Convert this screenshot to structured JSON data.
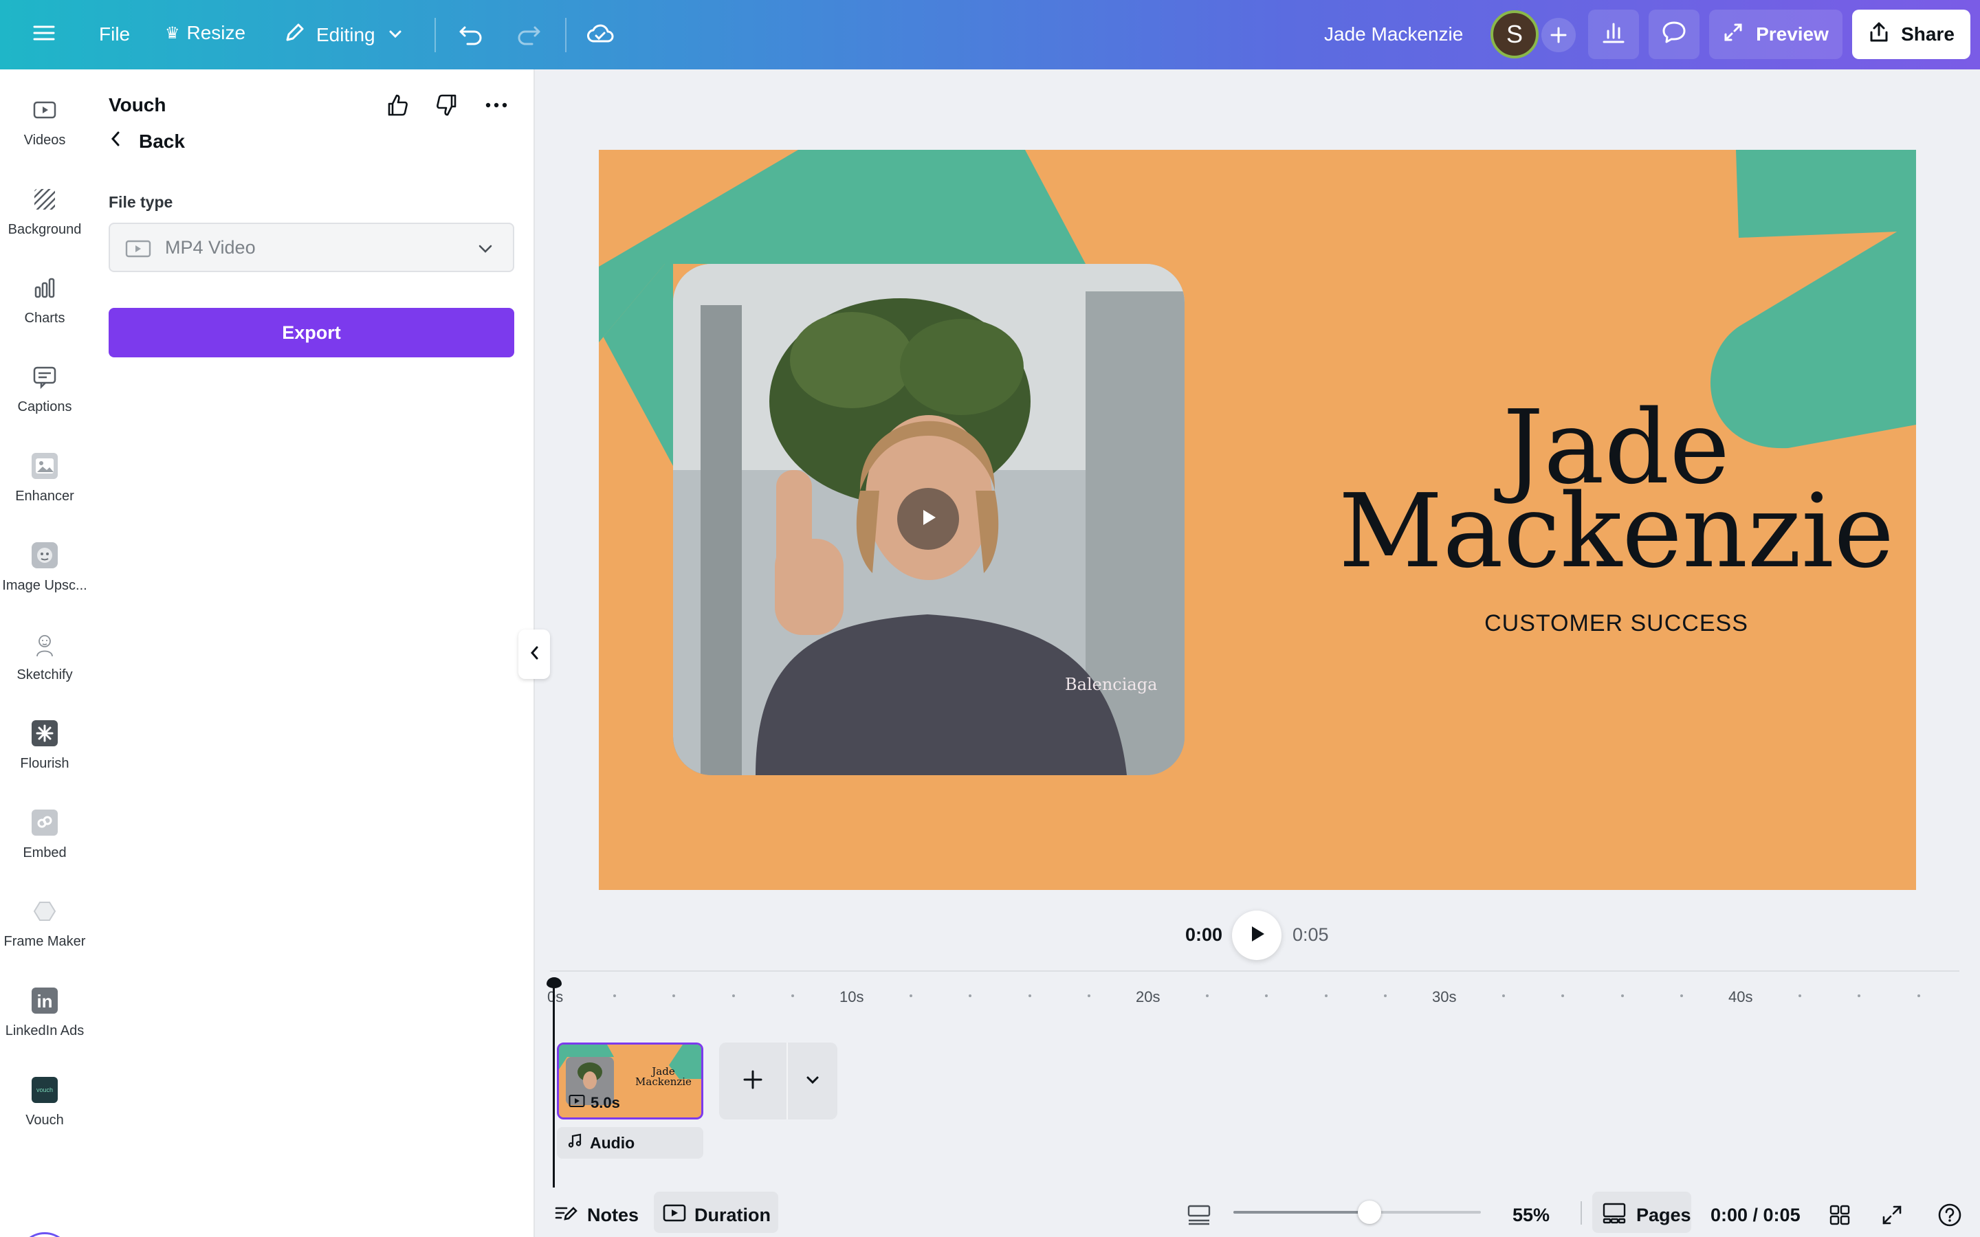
{
  "topbar": {
    "file_label": "File",
    "resize_label": "Resize",
    "editing_label": "Editing",
    "doc_title": "Jade Mackenzie",
    "avatar_initial": "S",
    "preview_label": "Preview",
    "share_label": "Share"
  },
  "rail": {
    "items": [
      {
        "label": "Videos",
        "icon": "video-icon"
      },
      {
        "label": "Background",
        "icon": "background-icon"
      },
      {
        "label": "Charts",
        "icon": "charts-icon"
      },
      {
        "label": "Captions",
        "icon": "captions-icon"
      },
      {
        "label": "Enhancer",
        "icon": "enhancer-icon"
      },
      {
        "label": "Image Upsc...",
        "icon": "image-upscaler-icon"
      },
      {
        "label": "Sketchify",
        "icon": "sketchify-icon"
      },
      {
        "label": "Flourish",
        "icon": "flourish-icon"
      },
      {
        "label": "Embed",
        "icon": "embed-icon"
      },
      {
        "label": "Frame Maker",
        "icon": "frame-maker-icon"
      },
      {
        "label": "LinkedIn Ads",
        "icon": "linkedin-icon"
      },
      {
        "label": "Vouch",
        "icon": "vouch-icon"
      }
    ],
    "linkedin_glyph": "in",
    "vouch_glyph": "vouch"
  },
  "panel": {
    "title": "Vouch",
    "back_label": "Back",
    "file_type_label": "File type",
    "file_type_value": "MP4 Video",
    "export_label": "Export"
  },
  "slide": {
    "name_line1": "Jade",
    "name_line2": "Mackenzie",
    "subtitle": "CUSTOMER SUCCESS",
    "shirt_text": "Balenciaga",
    "colors": {
      "background": "#f0a860",
      "accent": "#52b597"
    }
  },
  "playback": {
    "current": "0:00",
    "total": "0:05"
  },
  "timeline": {
    "ticks": [
      "0s",
      "10s",
      "20s",
      "30s",
      "40s"
    ],
    "clip_duration": "5.0s",
    "clip_name_line1": "Jade",
    "clip_name_line2": "Mackenzie",
    "audio_label": "Audio"
  },
  "bottombar": {
    "notes_label": "Notes",
    "duration_label": "Duration",
    "zoom_value": "55%",
    "zoom_fraction": 0.55,
    "pages_label": "Pages",
    "time_readout": "0:00 / 0:05"
  }
}
